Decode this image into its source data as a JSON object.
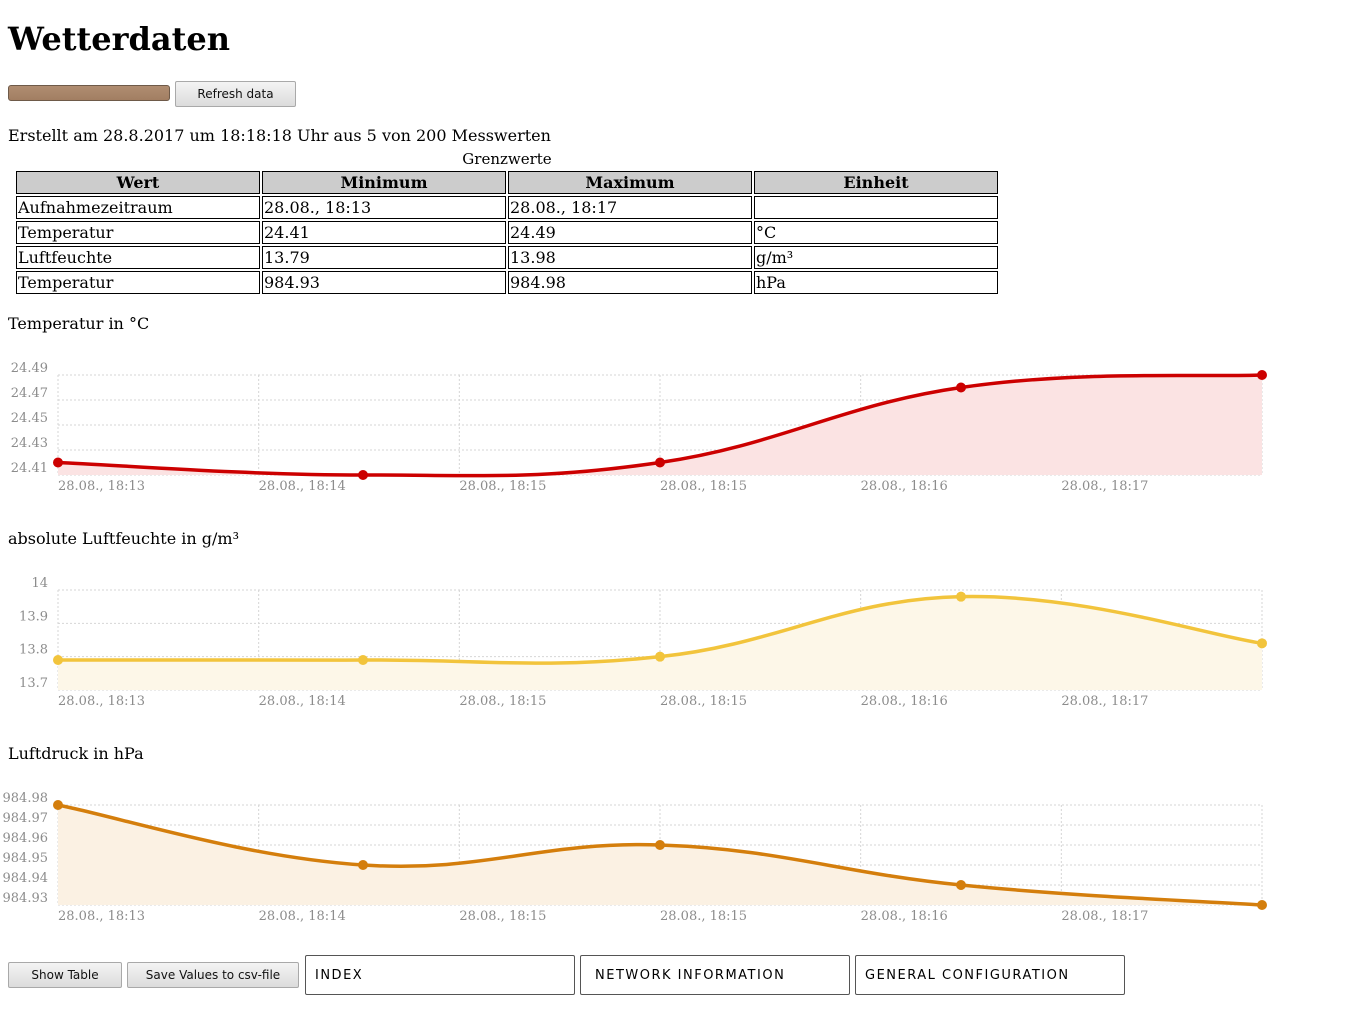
{
  "page": {
    "title": "Wetterdaten"
  },
  "controls": {
    "progress_fraction": 1.0,
    "refresh_label": "Refresh data"
  },
  "info_text": "Erstellt am 28.8.2017 um 18:18:18 Uhr aus 5 von 200 Messwerten",
  "limits_table": {
    "caption": "Grenzwerte",
    "headers": [
      "Wert",
      "Minimum",
      "Maximum",
      "Einheit"
    ],
    "rows": [
      [
        "Aufnahmezeitraum",
        "28.08., 18:13",
        "28.08., 18:17",
        ""
      ],
      [
        "Temperatur",
        "24.41",
        "24.49",
        "°C"
      ],
      [
        "Luftfeuchte",
        "13.79",
        "13.98",
        "g/m³"
      ],
      [
        "Temperatur",
        "984.93",
        "984.98",
        "hPa"
      ]
    ]
  },
  "chart_data": [
    {
      "type": "area",
      "title": "Temperatur in °C",
      "x_ticks": [
        "28.08., 18:13",
        "28.08., 18:14",
        "28.08., 18:15",
        "28.08., 18:15",
        "28.08., 18:16",
        "28.08., 18:17"
      ],
      "y_ticks": [
        "24.41",
        "24.43",
        "24.45",
        "24.47",
        "24.49"
      ],
      "ylim": [
        24.41,
        24.49
      ],
      "x": [
        0,
        1.52,
        3.0,
        4.5,
        6.0
      ],
      "values": [
        24.42,
        24.41,
        24.42,
        24.48,
        24.49
      ],
      "line_color": "#cc0000",
      "fill_color": "#fbe3e3",
      "grid": true
    },
    {
      "type": "area",
      "title": "absolute Luftfeuchte in g/m³",
      "x_ticks": [
        "28.08., 18:13",
        "28.08., 18:14",
        "28.08., 18:15",
        "28.08., 18:15",
        "28.08., 18:16",
        "28.08., 18:17"
      ],
      "y_ticks": [
        "13.7",
        "13.8",
        "13.9",
        "14"
      ],
      "ylim": [
        13.7,
        14.0
      ],
      "x": [
        0,
        1.52,
        3.0,
        4.5,
        6.0
      ],
      "values": [
        13.79,
        13.79,
        13.8,
        13.98,
        13.84
      ],
      "line_color": "#f2c43c",
      "fill_color": "#fdf7e8",
      "grid": true
    },
    {
      "type": "area",
      "title": "Luftdruck in hPa",
      "x_ticks": [
        "28.08., 18:13",
        "28.08., 18:14",
        "28.08., 18:15",
        "28.08., 18:15",
        "28.08., 18:16",
        "28.08., 18:17"
      ],
      "y_ticks": [
        "984.93",
        "984.94",
        "984.95",
        "984.96",
        "984.97",
        "984.98"
      ],
      "ylim": [
        984.93,
        984.98
      ],
      "x": [
        0,
        1.52,
        3.0,
        4.5,
        6.0
      ],
      "values": [
        984.98,
        984.95,
        984.96,
        984.94,
        984.93
      ],
      "line_color": "#d47e0c",
      "fill_color": "#fbf1e3",
      "grid": true
    }
  ],
  "footer": {
    "show_table_label": "Show Table",
    "save_csv_label": "Save Values to csv-file",
    "nav": [
      "INDEX",
      "NETWORK INFORMATION",
      "GENERAL CONFIGURATION"
    ]
  }
}
